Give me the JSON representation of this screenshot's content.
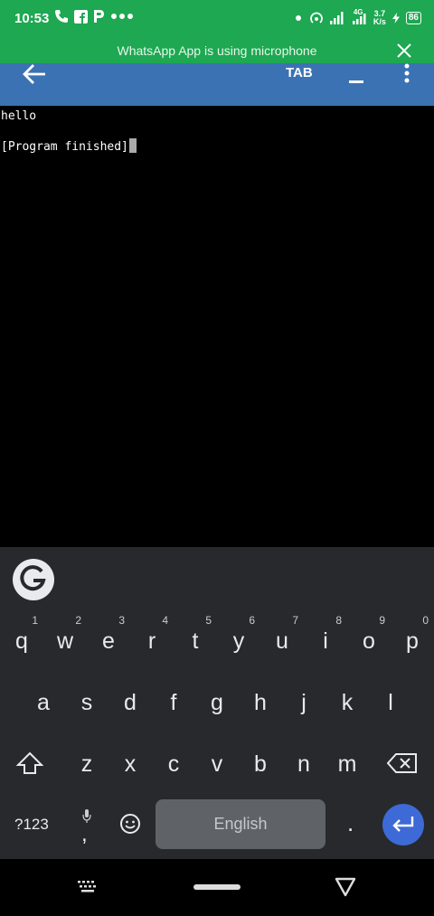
{
  "status_bar": {
    "time": "10:53",
    "icons": [
      "phone-icon",
      "facebook-icon",
      "paytm-icon",
      "more-dots-icon",
      "dot-icon",
      "hotspot-icon",
      "signal-icon",
      "4g-signal-icon",
      "battery-charging-icon"
    ],
    "net_speed_top": "3.7",
    "net_speed_bottom": "K/s",
    "net_label": "4G",
    "battery": "86",
    "colors": {
      "bg": "#1da851"
    }
  },
  "banner": {
    "message": "WhatsApp App is using microphone",
    "close_icon": "close-icon"
  },
  "app_bar": {
    "back_icon": "arrow-left-icon",
    "tab_label": "TAB",
    "minimize_icon": "minus-icon",
    "menu_icon": "more-vert-icon",
    "color": "#3b72b3"
  },
  "terminal": {
    "lines": [
      "hello",
      "[Program finished]"
    ]
  },
  "keyboard": {
    "grammarly_icon": "grammarly-g-icon",
    "row1": [
      {
        "ch": "q",
        "hint": "1"
      },
      {
        "ch": "w",
        "hint": "2"
      },
      {
        "ch": "e",
        "hint": "3"
      },
      {
        "ch": "r",
        "hint": "4"
      },
      {
        "ch": "t",
        "hint": "5"
      },
      {
        "ch": "y",
        "hint": "6"
      },
      {
        "ch": "u",
        "hint": "7"
      },
      {
        "ch": "i",
        "hint": "8"
      },
      {
        "ch": "o",
        "hint": "9"
      },
      {
        "ch": "p",
        "hint": "0"
      }
    ],
    "row2": [
      "a",
      "s",
      "d",
      "f",
      "g",
      "h",
      "j",
      "k",
      "l"
    ],
    "row3": [
      "z",
      "x",
      "c",
      "v",
      "b",
      "n",
      "m"
    ],
    "symbols_label": "?123",
    "comma_label": ",",
    "space_label": "English",
    "period_label": ".",
    "shift_icon": "shift-icon",
    "backspace_icon": "backspace-icon",
    "mic_icon": "mic-icon",
    "emoji_icon": "emoji-icon",
    "enter_icon": "enter-icon",
    "enter_color": "#3d6ad6"
  },
  "nav_bar": {
    "icons": [
      "keyboard-switch-icon",
      "home-pill-icon",
      "back-triangle-icon"
    ]
  }
}
